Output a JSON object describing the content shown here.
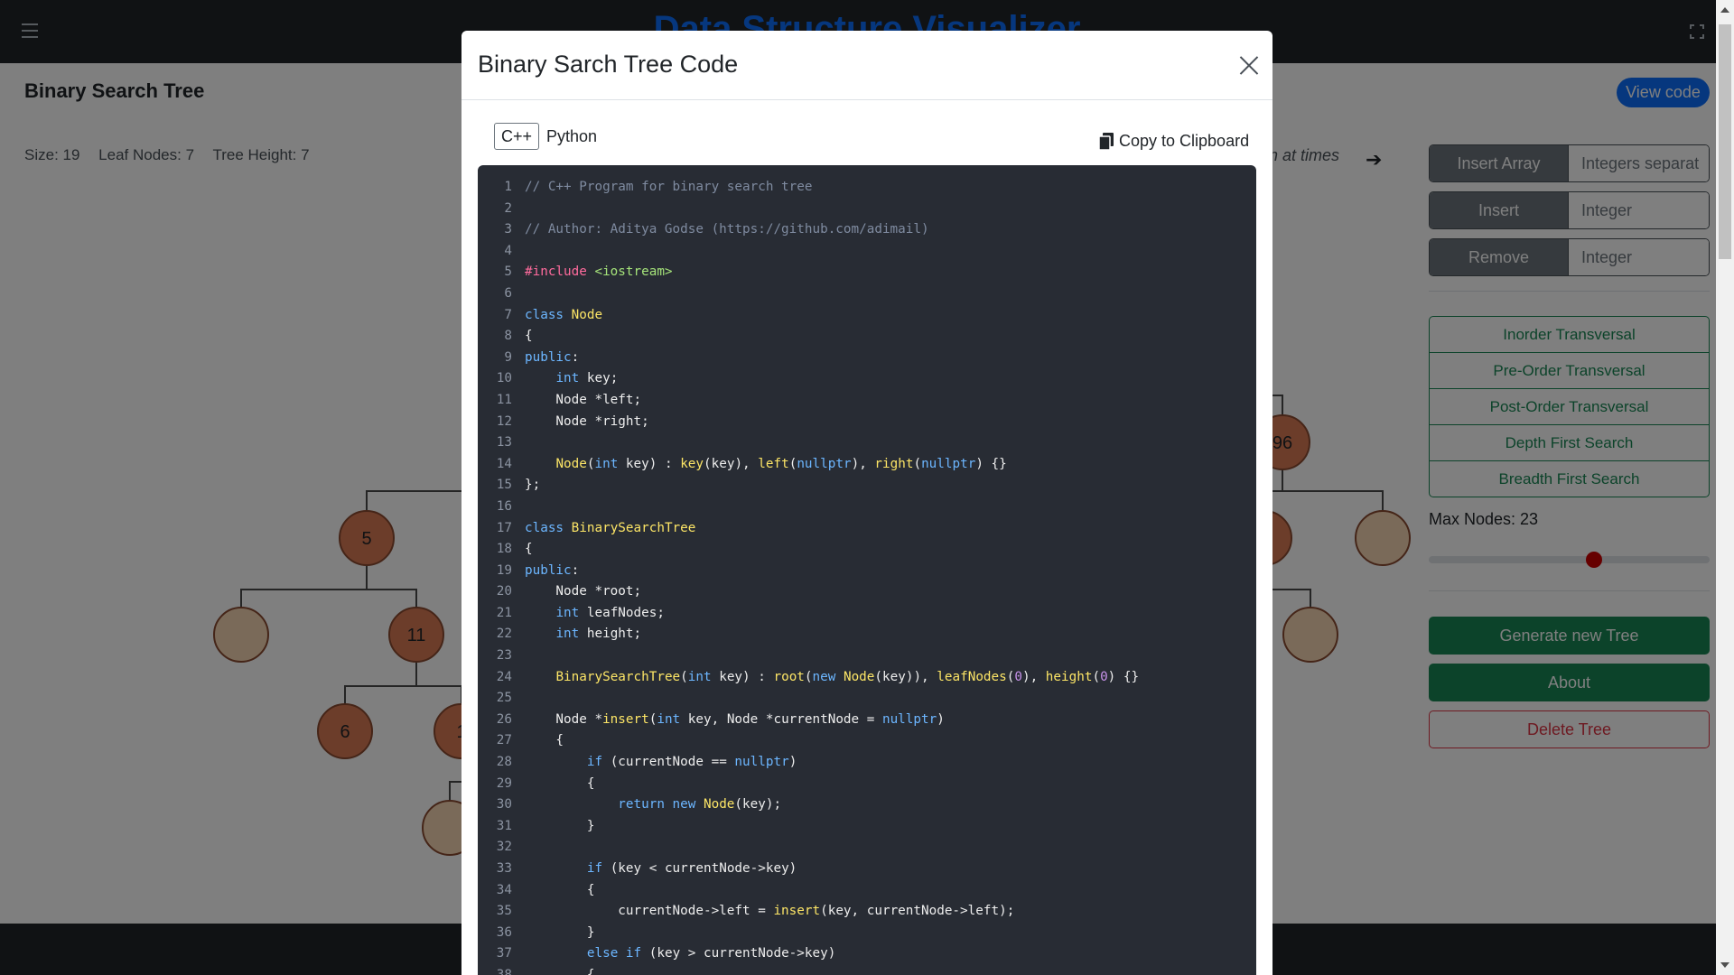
{
  "app": {
    "title": "Data Structure Visualizer"
  },
  "page": {
    "title": "Binary Search Tree",
    "view_code_label": "View code",
    "stats": {
      "size": "Size: 19",
      "leaf_nodes": "Leaf Nodes: 7",
      "tree_height": "Tree Height: 7"
    },
    "animation_text": "n at times"
  },
  "sidebar": {
    "insert_array": {
      "label": "Insert Array",
      "placeholder": "Integers separat"
    },
    "insert": {
      "label": "Insert",
      "placeholder": "Integer"
    },
    "remove": {
      "label": "Remove",
      "placeholder": "Integer"
    },
    "traversals": [
      "Inorder Transversal",
      "Pre-Order Transversal",
      "Post-Order Transversal",
      "Depth First Search",
      "Breadth First Search"
    ],
    "max_nodes_label": "Max Nodes: 23",
    "max_nodes_fraction": 0.59,
    "generate_label": "Generate new Tree",
    "about_label": "About",
    "delete_label": "Delete Tree"
  },
  "tree": {
    "nodes": [
      {
        "label": "5",
        "filled": true
      },
      {
        "label": "",
        "filled": false
      },
      {
        "label": "11",
        "filled": true
      },
      {
        "label": "6",
        "filled": true
      },
      {
        "label": "1",
        "filled": true
      },
      {
        "label": "",
        "filled": false
      },
      {
        "label": "96",
        "filled": true
      },
      {
        "label": "",
        "filled": true
      },
      {
        "label": "",
        "filled": false
      },
      {
        "label": "",
        "filled": false
      }
    ]
  },
  "modal": {
    "title": "Binary Sarch Tree Code",
    "languages": [
      "C++",
      "Python"
    ],
    "active_language": "C++",
    "copy_label": "Copy to Clipboard",
    "code_lines": [
      [
        [
          "comment",
          "// C++ Program for binary search tree"
        ]
      ],
      [],
      [
        [
          "comment",
          "// Author: Aditya Godse (https://github.com/adimail)"
        ]
      ],
      [],
      [
        [
          "pre",
          "#include "
        ],
        [
          "str",
          "<iostream>"
        ]
      ],
      [],
      [
        [
          "kw",
          "class "
        ],
        [
          "cls",
          "Node"
        ]
      ],
      [
        [
          "txt",
          "{"
        ]
      ],
      [
        [
          "kw",
          "public"
        ],
        [
          "txt",
          ":"
        ]
      ],
      [
        [
          "txt",
          "    "
        ],
        [
          "kw",
          "int"
        ],
        [
          "txt",
          " key;"
        ]
      ],
      [
        [
          "txt",
          "    Node *left;"
        ]
      ],
      [
        [
          "txt",
          "    Node *right;"
        ]
      ],
      [],
      [
        [
          "txt",
          "    "
        ],
        [
          "fn",
          "Node"
        ],
        [
          "txt",
          "("
        ],
        [
          "kw",
          "int"
        ],
        [
          "txt",
          " key) : "
        ],
        [
          "fn",
          "key"
        ],
        [
          "txt",
          "(key), "
        ],
        [
          "fn",
          "left"
        ],
        [
          "txt",
          "("
        ],
        [
          "kw",
          "nullptr"
        ],
        [
          "txt",
          "), "
        ],
        [
          "fn",
          "right"
        ],
        [
          "txt",
          "("
        ],
        [
          "kw",
          "nullptr"
        ],
        [
          "txt",
          ") {}"
        ]
      ],
      [
        [
          "txt",
          "};"
        ]
      ],
      [],
      [
        [
          "kw",
          "class "
        ],
        [
          "cls",
          "BinarySearchTree"
        ]
      ],
      [
        [
          "txt",
          "{"
        ]
      ],
      [
        [
          "kw",
          "public"
        ],
        [
          "txt",
          ":"
        ]
      ],
      [
        [
          "txt",
          "    Node *root;"
        ]
      ],
      [
        [
          "txt",
          "    "
        ],
        [
          "kw",
          "int"
        ],
        [
          "txt",
          " leafNodes;"
        ]
      ],
      [
        [
          "txt",
          "    "
        ],
        [
          "kw",
          "int"
        ],
        [
          "txt",
          " height;"
        ]
      ],
      [],
      [
        [
          "txt",
          "    "
        ],
        [
          "fn",
          "BinarySearchTree"
        ],
        [
          "txt",
          "("
        ],
        [
          "kw",
          "int"
        ],
        [
          "txt",
          " key) : "
        ],
        [
          "fn",
          "root"
        ],
        [
          "txt",
          "("
        ],
        [
          "kw",
          "new "
        ],
        [
          "fn",
          "Node"
        ],
        [
          "txt",
          "(key)), "
        ],
        [
          "fn",
          "leafNodes"
        ],
        [
          "txt",
          "("
        ],
        [
          "num",
          "0"
        ],
        [
          "txt",
          "), "
        ],
        [
          "fn",
          "height"
        ],
        [
          "txt",
          "("
        ],
        [
          "num",
          "0"
        ],
        [
          "txt",
          ") {}"
        ]
      ],
      [],
      [
        [
          "txt",
          "    Node *"
        ],
        [
          "fn",
          "insert"
        ],
        [
          "txt",
          "("
        ],
        [
          "kw",
          "int"
        ],
        [
          "txt",
          " key, Node *currentNode = "
        ],
        [
          "kw",
          "nullptr"
        ],
        [
          "txt",
          ")"
        ]
      ],
      [
        [
          "txt",
          "    {"
        ]
      ],
      [
        [
          "txt",
          "        "
        ],
        [
          "kw",
          "if"
        ],
        [
          "txt",
          " (currentNode == "
        ],
        [
          "kw",
          "nullptr"
        ],
        [
          "txt",
          ")"
        ]
      ],
      [
        [
          "txt",
          "        {"
        ]
      ],
      [
        [
          "txt",
          "            "
        ],
        [
          "kw",
          "return new "
        ],
        [
          "fn",
          "Node"
        ],
        [
          "txt",
          "(key);"
        ]
      ],
      [
        [
          "txt",
          "        }"
        ]
      ],
      [],
      [
        [
          "txt",
          "        "
        ],
        [
          "kw",
          "if"
        ],
        [
          "txt",
          " (key < currentNode->key)"
        ]
      ],
      [
        [
          "txt",
          "        {"
        ]
      ],
      [
        [
          "txt",
          "            currentNode->left = "
        ],
        [
          "fn",
          "insert"
        ],
        [
          "txt",
          "(key, currentNode->left);"
        ]
      ],
      [
        [
          "txt",
          "        }"
        ]
      ],
      [
        [
          "txt",
          "        "
        ],
        [
          "kw",
          "else if"
        ],
        [
          "txt",
          " (key > currentNode->key)"
        ]
      ],
      [
        [
          "txt",
          "        {"
        ]
      ]
    ]
  }
}
